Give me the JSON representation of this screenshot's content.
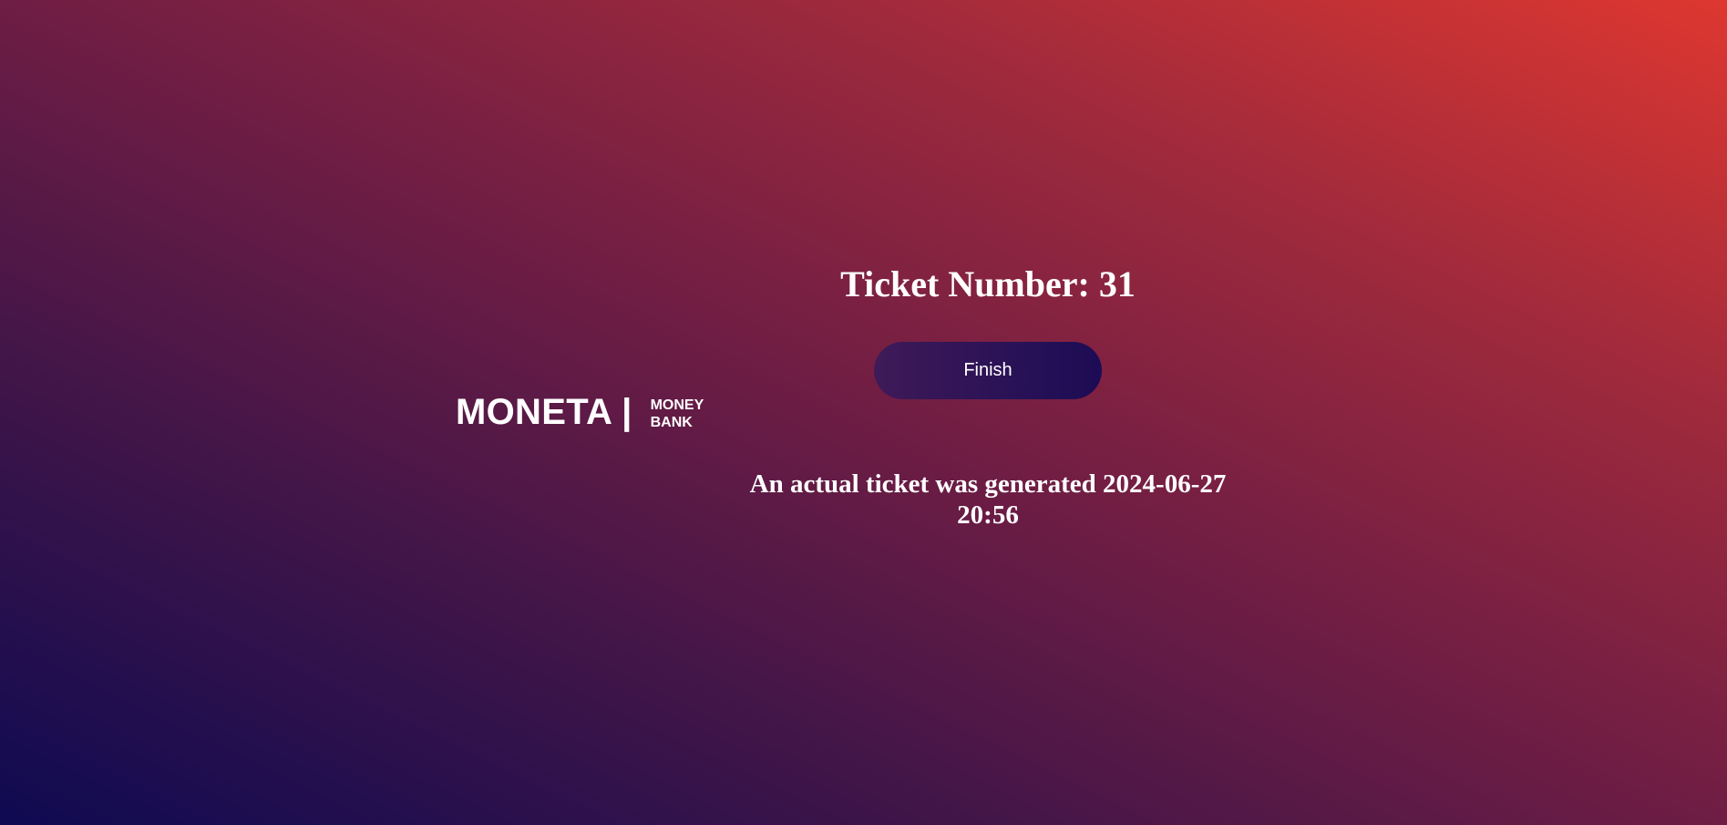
{
  "logo": {
    "main": "MONETA |",
    "sub_line1": "MONEY",
    "sub_line2": "BANK"
  },
  "ticket": {
    "title": "Ticket Number: 31",
    "finish_label": "Finish",
    "generated_line1": "An actual ticket was generated 2024-06-27",
    "generated_line2": "20:56"
  },
  "colors": {
    "gradient_bottom_left": "#0f0a52",
    "gradient_top_right": "#de3730",
    "button_left": "#3f1a58",
    "button_right": "#1c0c55",
    "text": "#ffffff"
  }
}
